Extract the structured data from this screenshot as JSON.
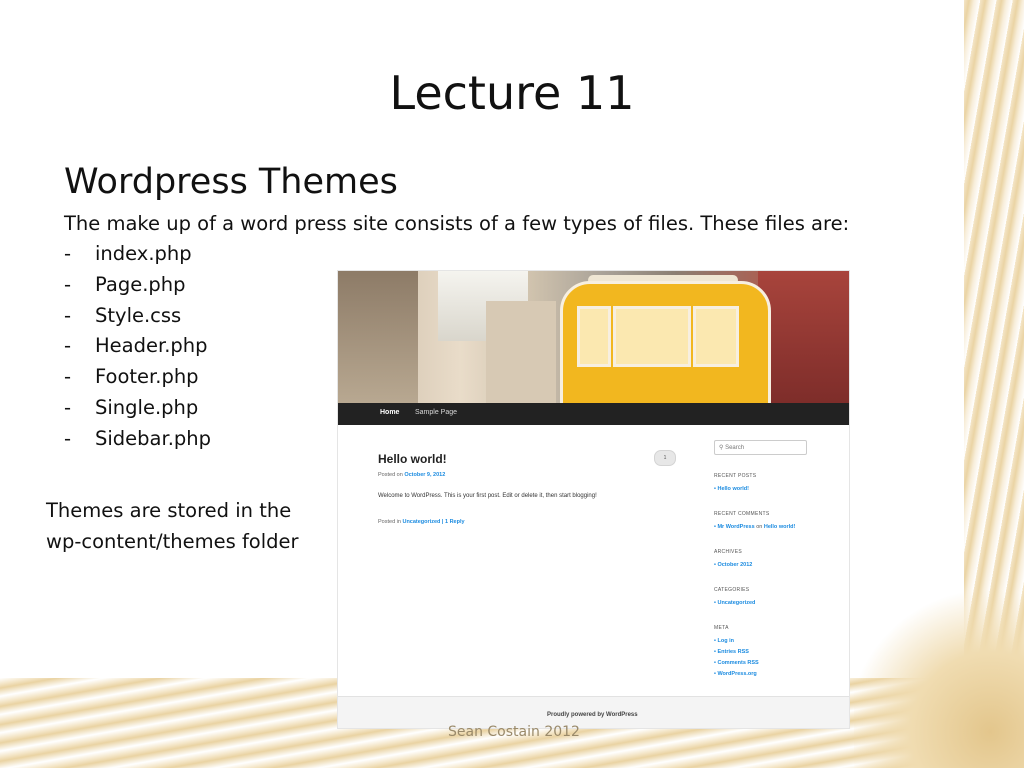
{
  "slide": {
    "title": "Lecture 11",
    "heading": "Wordpress Themes",
    "intro": "The make up of a word press site consists of a few types of files. These files are:",
    "files": [
      {
        "dash": "-",
        "name": "index.php"
      },
      {
        "dash": "-",
        "name": "Page.php"
      },
      {
        "dash": "-",
        "name": "Style.css"
      },
      {
        "dash": "-",
        "name": "Header.php"
      },
      {
        "dash": "-",
        "name": "Footer.php"
      },
      {
        "dash": "-",
        "name": "Single.php"
      },
      {
        "dash": "-",
        "name": "Sidebar.php"
      }
    ],
    "note": "Themes are stored in the wp-content/themes folder",
    "footer": "Sean Costain 2012"
  },
  "screenshot": {
    "nav": {
      "home": "Home",
      "sample_page": "Sample Page"
    },
    "post": {
      "title": "Hello world!",
      "posted_on": "Posted on",
      "date": "October 9, 2012",
      "content": "Welcome to WordPress. This is your first post. Edit or delete it, then start blogging!",
      "posted_in": "Posted in",
      "category": "Uncategorized",
      "separator": "|",
      "reply": "1 Reply",
      "comment_count": "1"
    },
    "sidebar": {
      "search_placeholder": "Search",
      "recent_posts_heading": "RECENT POSTS",
      "recent_post": "Hello world!",
      "recent_comments_heading": "RECENT COMMENTS",
      "comment_author": "Mr WordPress",
      "comment_on": "on",
      "comment_post": "Hello world!",
      "archives_heading": "ARCHIVES",
      "archive": "October 2012",
      "categories_heading": "CATEGORIES",
      "category": "Uncategorized",
      "meta_heading": "META",
      "meta_links": [
        "Log in",
        "Entries RSS",
        "Comments RSS",
        "WordPress.org"
      ]
    },
    "footer": "Proudly powered by WordPress"
  }
}
